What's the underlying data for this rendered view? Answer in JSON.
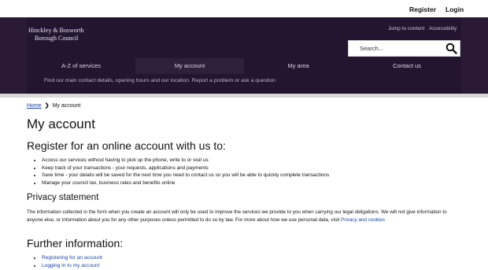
{
  "topbar": {
    "register": "Register",
    "login": "Login"
  },
  "header": {
    "logo_line1": "Hinckley & Bosworth",
    "logo_line2": "Borough Council",
    "jump_to_content": "Jump to content",
    "accessibility": "Accessibility",
    "search_placeholder": "Search...",
    "nav": [
      "A-Z of services",
      "My account",
      "My area",
      "Contact us"
    ],
    "subnav": "Find our main contact details, opening hours and our location. Report a problem or ask a question"
  },
  "breadcrumb": {
    "home": "Home",
    "current": "My account"
  },
  "page": {
    "title": "My account",
    "register_heading": "Register for an online account with us to:",
    "benefits": [
      "Access our services without having to pick up the phone, write to or visit us",
      "Keep track of your transactions - your requests, applications and payments",
      "Save time - your details will be saved for the next time you need to contact us so you will be able to quickly complete transactions",
      "Manage your council tax, business rates and benefits online"
    ],
    "privacy_heading": "Privacy statement",
    "privacy_text": "The information collected in the form when you create an account will only be used to improve the services we provide to you when carrying our legal obligations. We will not give information to anyone else, or information about you for any other purposes unless permitted to do so by law. For more about how we use personal data, visit ",
    "privacy_link": "Privacy and cookies",
    "further_heading": "Further information:",
    "further_links": [
      "Registering for an account",
      "Logging in to my account"
    ]
  }
}
